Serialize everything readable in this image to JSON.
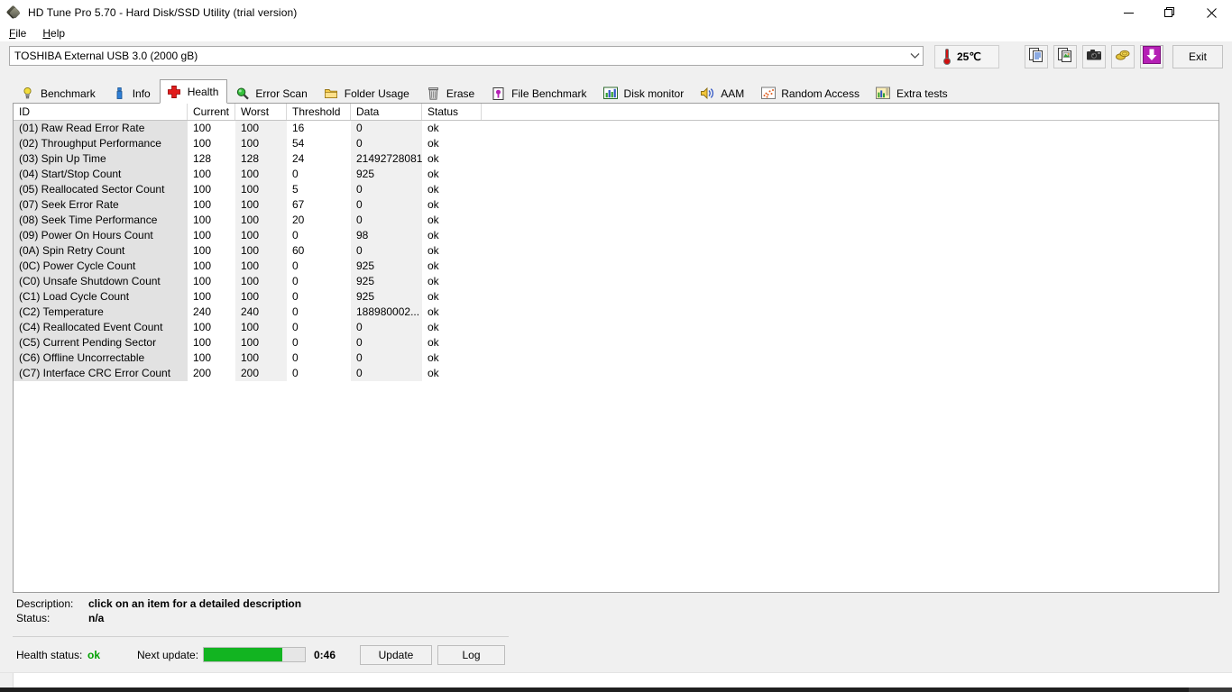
{
  "window": {
    "title": "HD Tune Pro 5.70 - Hard Disk/SSD Utility (trial version)",
    "icon": "app-diamond-icon",
    "minimize": "minimize-icon",
    "restore": "restore-icon",
    "close": "close-icon"
  },
  "menu": {
    "items": [
      {
        "label": "File",
        "accel": "F"
      },
      {
        "label": "Help",
        "accel": "H"
      }
    ]
  },
  "toolbar": {
    "drive_selected": "TOSHIBA External USB 3.0 (2000 gB)",
    "drive_dropdown_icon": "chevron-down-icon",
    "temperature": "25℃",
    "temperature_icon": "thermometer-icon",
    "buttons": [
      {
        "name": "copy-text-button",
        "icon": "copy-text-icon"
      },
      {
        "name": "copy-image-button",
        "icon": "copy-image-icon"
      },
      {
        "name": "screenshot-button",
        "icon": "camera-icon"
      },
      {
        "name": "coins-button",
        "icon": "coins-icon"
      },
      {
        "name": "download-button",
        "icon": "download-arrow-icon"
      }
    ],
    "exit_label": "Exit"
  },
  "tabs": [
    {
      "label": "Benchmark",
      "icon": "lightbulb-icon",
      "active": false
    },
    {
      "label": "Info",
      "icon": "info-icon",
      "active": false
    },
    {
      "label": "Health",
      "icon": "red-cross-icon",
      "active": true
    },
    {
      "label": "Error Scan",
      "icon": "magnifier-icon",
      "active": false
    },
    {
      "label": "Folder Usage",
      "icon": "folder-icon",
      "active": false
    },
    {
      "label": "Erase",
      "icon": "trash-icon",
      "active": false
    },
    {
      "label": "File Benchmark",
      "icon": "file-benchmark-icon",
      "active": false
    },
    {
      "label": "Disk monitor",
      "icon": "bar-chart-icon",
      "active": false
    },
    {
      "label": "AAM",
      "icon": "speaker-icon",
      "active": false
    },
    {
      "label": "Random Access",
      "icon": "scatter-icon",
      "active": false
    },
    {
      "label": "Extra tests",
      "icon": "extra-chart-icon",
      "active": false
    }
  ],
  "table": {
    "columns": [
      "ID",
      "Current",
      "Worst",
      "Threshold",
      "Data",
      "Status"
    ],
    "rows": [
      {
        "id": "(01) Raw Read Error Rate",
        "current": "100",
        "worst": "100",
        "threshold": "16",
        "data": "0",
        "status": "ok"
      },
      {
        "id": "(02) Throughput Performance",
        "current": "100",
        "worst": "100",
        "threshold": "54",
        "data": "0",
        "status": "ok"
      },
      {
        "id": "(03) Spin Up Time",
        "current": "128",
        "worst": "128",
        "threshold": "24",
        "data": "21492728081",
        "status": "ok"
      },
      {
        "id": "(04) Start/Stop Count",
        "current": "100",
        "worst": "100",
        "threshold": "0",
        "data": "925",
        "status": "ok"
      },
      {
        "id": "(05) Reallocated Sector Count",
        "current": "100",
        "worst": "100",
        "threshold": "5",
        "data": "0",
        "status": "ok"
      },
      {
        "id": "(07) Seek Error Rate",
        "current": "100",
        "worst": "100",
        "threshold": "67",
        "data": "0",
        "status": "ok"
      },
      {
        "id": "(08) Seek Time Performance",
        "current": "100",
        "worst": "100",
        "threshold": "20",
        "data": "0",
        "status": "ok"
      },
      {
        "id": "(09) Power On Hours Count",
        "current": "100",
        "worst": "100",
        "threshold": "0",
        "data": "98",
        "status": "ok"
      },
      {
        "id": "(0A) Spin Retry Count",
        "current": "100",
        "worst": "100",
        "threshold": "60",
        "data": "0",
        "status": "ok"
      },
      {
        "id": "(0C) Power Cycle Count",
        "current": "100",
        "worst": "100",
        "threshold": "0",
        "data": "925",
        "status": "ok"
      },
      {
        "id": "(C0) Unsafe Shutdown Count",
        "current": "100",
        "worst": "100",
        "threshold": "0",
        "data": "925",
        "status": "ok"
      },
      {
        "id": "(C1) Load Cycle Count",
        "current": "100",
        "worst": "100",
        "threshold": "0",
        "data": "925",
        "status": "ok"
      },
      {
        "id": "(C2) Temperature",
        "current": "240",
        "worst": "240",
        "threshold": "0",
        "data": "188980002...",
        "status": "ok"
      },
      {
        "id": "(C4) Reallocated Event Count",
        "current": "100",
        "worst": "100",
        "threshold": "0",
        "data": "0",
        "status": "ok"
      },
      {
        "id": "(C5) Current Pending Sector",
        "current": "100",
        "worst": "100",
        "threshold": "0",
        "data": "0",
        "status": "ok"
      },
      {
        "id": "(C6) Offline Uncorrectable",
        "current": "100",
        "worst": "100",
        "threshold": "0",
        "data": "0",
        "status": "ok"
      },
      {
        "id": "(C7) Interface CRC Error Count",
        "current": "200",
        "worst": "200",
        "threshold": "0",
        "data": "0",
        "status": "ok"
      }
    ]
  },
  "description": {
    "label": "Description:",
    "value": "click on an item for a detailed description",
    "status_label": "Status:",
    "status_value": "n/a"
  },
  "status": {
    "health_label": "Health status:",
    "health_value": "ok",
    "health_color": "#00a000",
    "next_update_label": "Next update:",
    "progress_percent": 78,
    "progress_color": "#12b421",
    "time_remaining": "0:46",
    "update_button": "Update",
    "log_button": "Log"
  }
}
